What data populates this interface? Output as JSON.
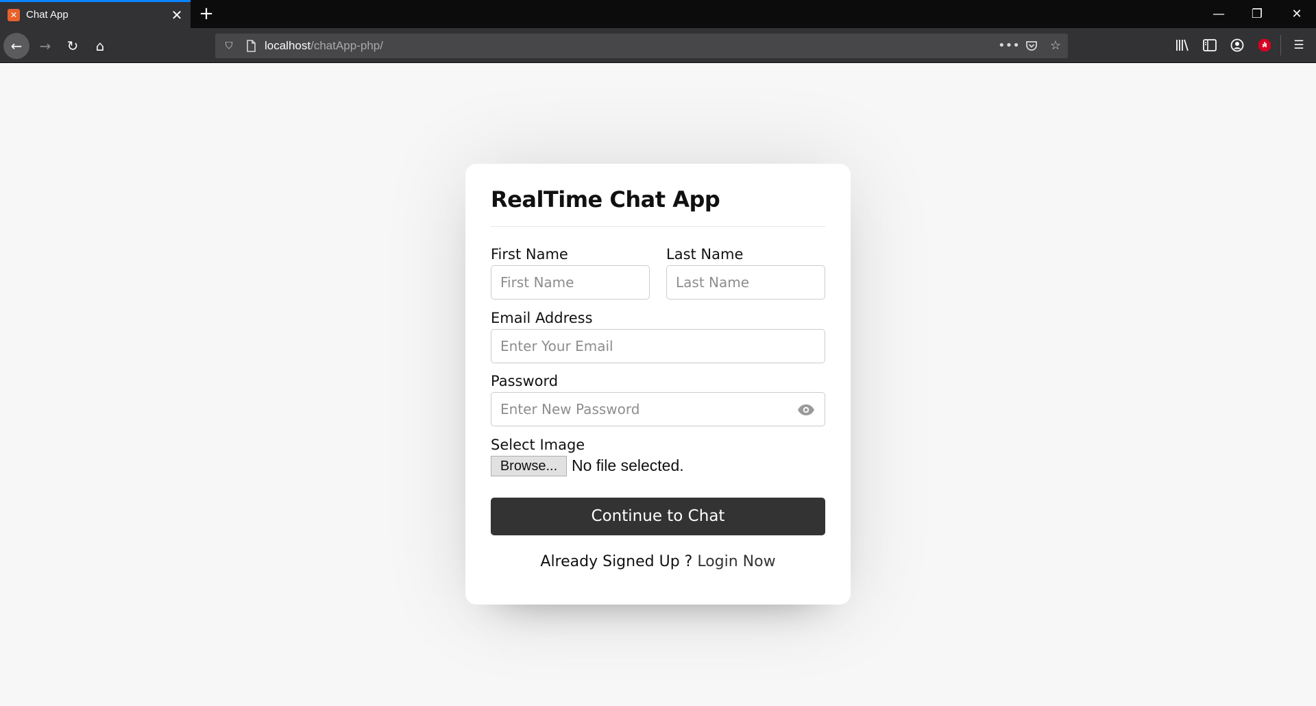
{
  "browser": {
    "tab_title": "Chat App",
    "tab_favicon_text": "✕",
    "url_host": "localhost",
    "url_path": "/chatApp-php/",
    "accent_color": "#0a84ff"
  },
  "page": {
    "title": "RealTime Chat App",
    "first_name": {
      "label": "First Name",
      "placeholder": "First Name"
    },
    "last_name": {
      "label": "Last Name",
      "placeholder": "Last Name"
    },
    "email": {
      "label": "Email Address",
      "placeholder": "Enter Your Email"
    },
    "password": {
      "label": "Password",
      "placeholder": "Enter New Password"
    },
    "image": {
      "label": "Select Image",
      "button": "Browse...",
      "status": "No file selected."
    },
    "submit_label": "Continue to Chat",
    "footer": {
      "text": "Already Signed Up ?",
      "link": "Login Now"
    }
  }
}
